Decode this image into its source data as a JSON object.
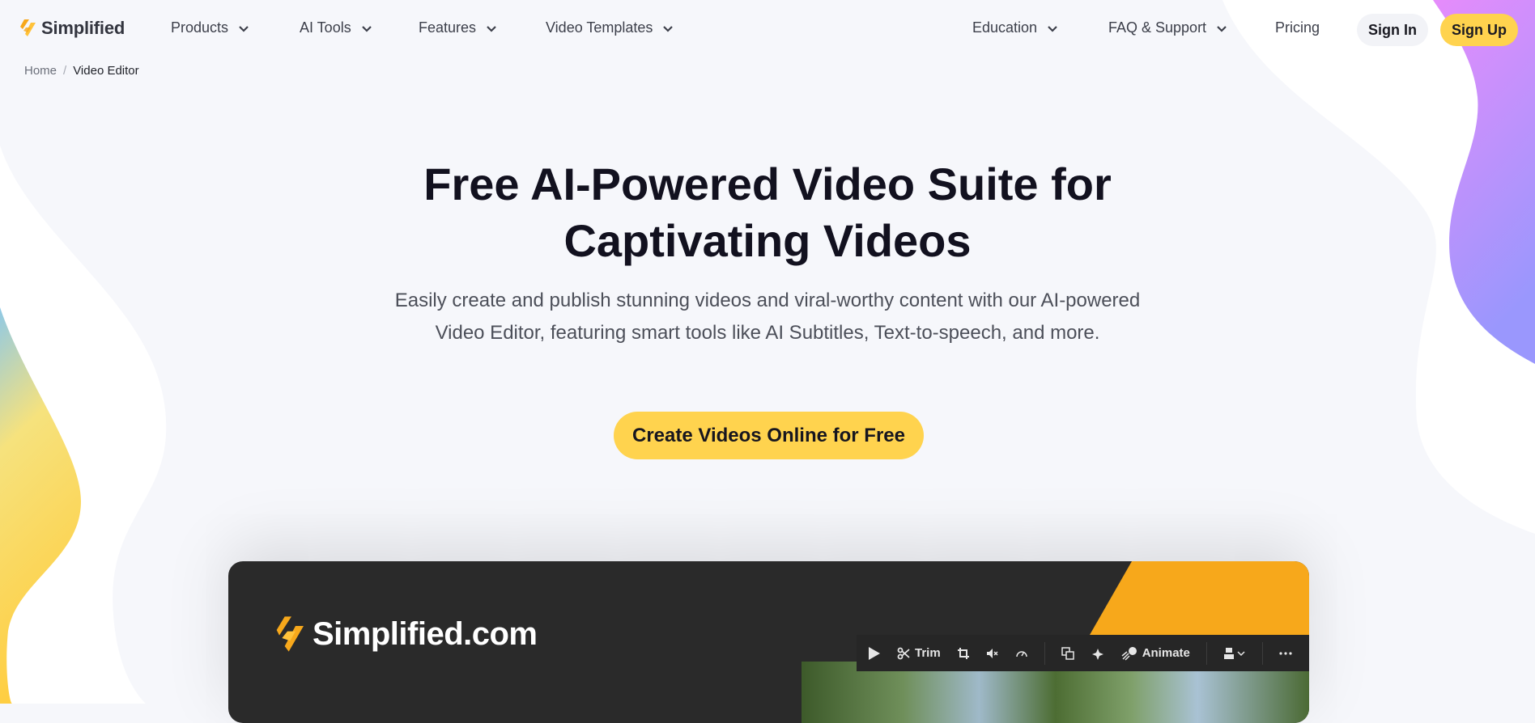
{
  "brand": {
    "name": "Simplified",
    "accent": "#f7a81b",
    "cta_color": "#ffd34e"
  },
  "nav": {
    "left_items": [
      {
        "label": "Products",
        "icon": "chevron-down-icon"
      },
      {
        "label": "AI Tools",
        "icon": "chevron-down-icon"
      },
      {
        "label": "Features",
        "icon": "chevron-down-icon"
      },
      {
        "label": "Video Templates",
        "icon": "chevron-down-icon"
      }
    ],
    "right_items": [
      {
        "label": "Education",
        "icon": "chevron-down-icon"
      },
      {
        "label": "FAQ & Support",
        "icon": "chevron-down-icon"
      }
    ],
    "pricing": "Pricing",
    "sign_in": "Sign In",
    "sign_up": "Sign Up"
  },
  "breadcrumb": {
    "home": "Home",
    "separator": "/",
    "current": "Video Editor"
  },
  "hero": {
    "title_line1": "Free AI-Powered Video Suite for",
    "title_line2": "Captivating Videos",
    "subtitle": "Easily create and publish stunning videos and viral-worthy content with our AI-powered Video Editor, featuring smart tools like AI Subtitles, Text-to-speech, and more.",
    "cta": "Create Videos Online for Free"
  },
  "preview": {
    "logo_text": "Simplified.com",
    "toolbar": {
      "play": "play-icon",
      "trim": "Trim",
      "crop": "crop-icon",
      "mute": "mute-icon",
      "speed": "speed-icon",
      "replace": "replace-media-icon",
      "magic": "sparkle-icon",
      "animate": "Animate",
      "position": "layer-position-icon",
      "more": "more-icon"
    }
  }
}
